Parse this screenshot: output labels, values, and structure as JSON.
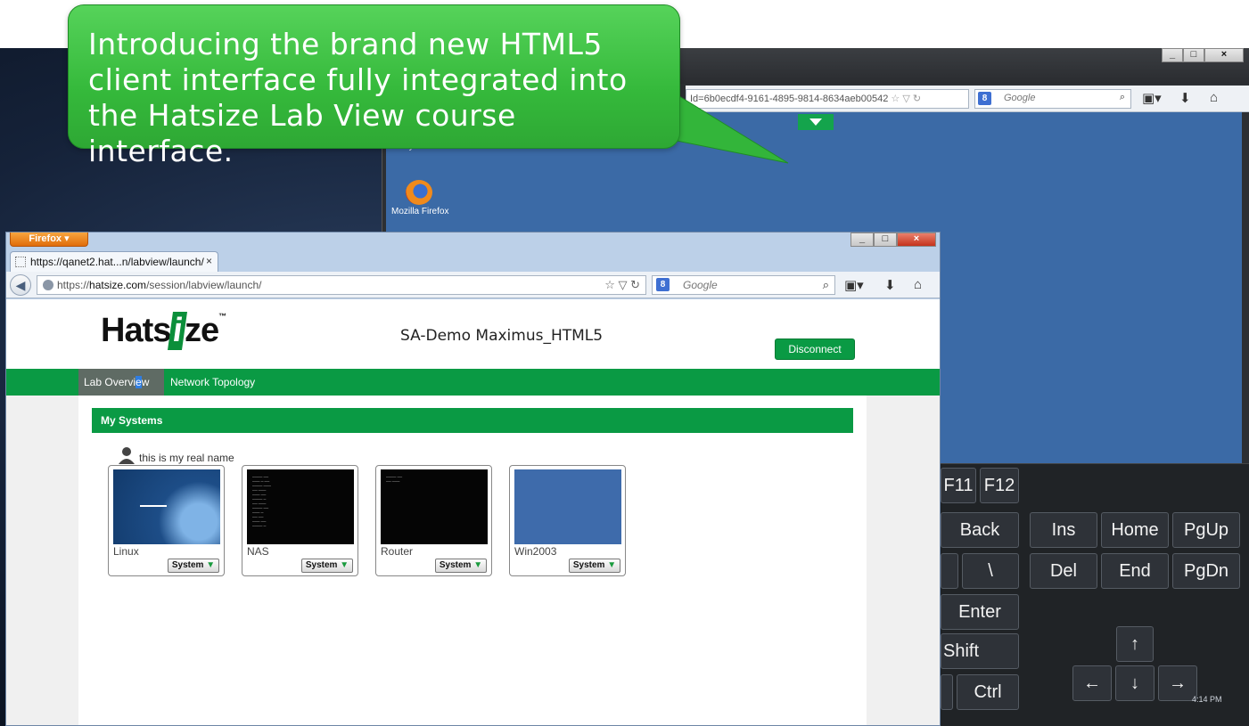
{
  "callout": {
    "line1": "Introducing the brand new HTML5",
    "line2": "client interface fully integrated into",
    "line3": "the Hatsize Lab View course interface."
  },
  "back_window": {
    "controls": [
      "_",
      "□",
      "×"
    ],
    "url_fragment": "Id=6b0ecdf4-9161-4895-9814-8634aeb00542",
    "search_placeholder": "Google",
    "search_badge": "8",
    "remote_desktop": {
      "recycle_bin_label": "Recycle Bin",
      "firefox_label": "Mozilla Firefox",
      "clock": "4:14 PM"
    },
    "keyboard": {
      "keys": [
        "F11",
        "F12",
        "Back",
        "Ins",
        "Home",
        "PgUp",
        "\\",
        "Del",
        "End",
        "PgDn",
        "Enter",
        "Shift",
        "↑",
        "Ctrl",
        "←",
        "↓",
        "→"
      ]
    }
  },
  "front_window": {
    "firefox_menu": "Firefox ▾",
    "controls": [
      "_",
      "□",
      "×"
    ],
    "tab_title": "https://qanet2.hat...n/labview/launch/",
    "tab_close": "×",
    "url_scheme": "https://",
    "url_host": "hatsize.com",
    "url_path": "/session/labview/launch/",
    "search_placeholder": "Google",
    "search_badge": "8"
  },
  "page": {
    "logo_pre": "Hats",
    "logo_i": "i",
    "logo_post": "ze",
    "logo_tm": "™",
    "session_title": "SA-Demo Maximus_HTML5",
    "disconnect_label": "Disconnect",
    "nav": {
      "lab_overview_a": "Lab Overvi",
      "lab_overview_b": "e",
      "lab_overview_c": "w",
      "network_topology": "Network Topology"
    },
    "my_systems_title": "My Systems",
    "user_name": "this is my real name",
    "systems": [
      {
        "name": "Linux",
        "button": "System"
      },
      {
        "name": "NAS",
        "button": "System"
      },
      {
        "name": "Router",
        "button": "System"
      },
      {
        "name": "Win2003",
        "button": "System"
      }
    ]
  }
}
